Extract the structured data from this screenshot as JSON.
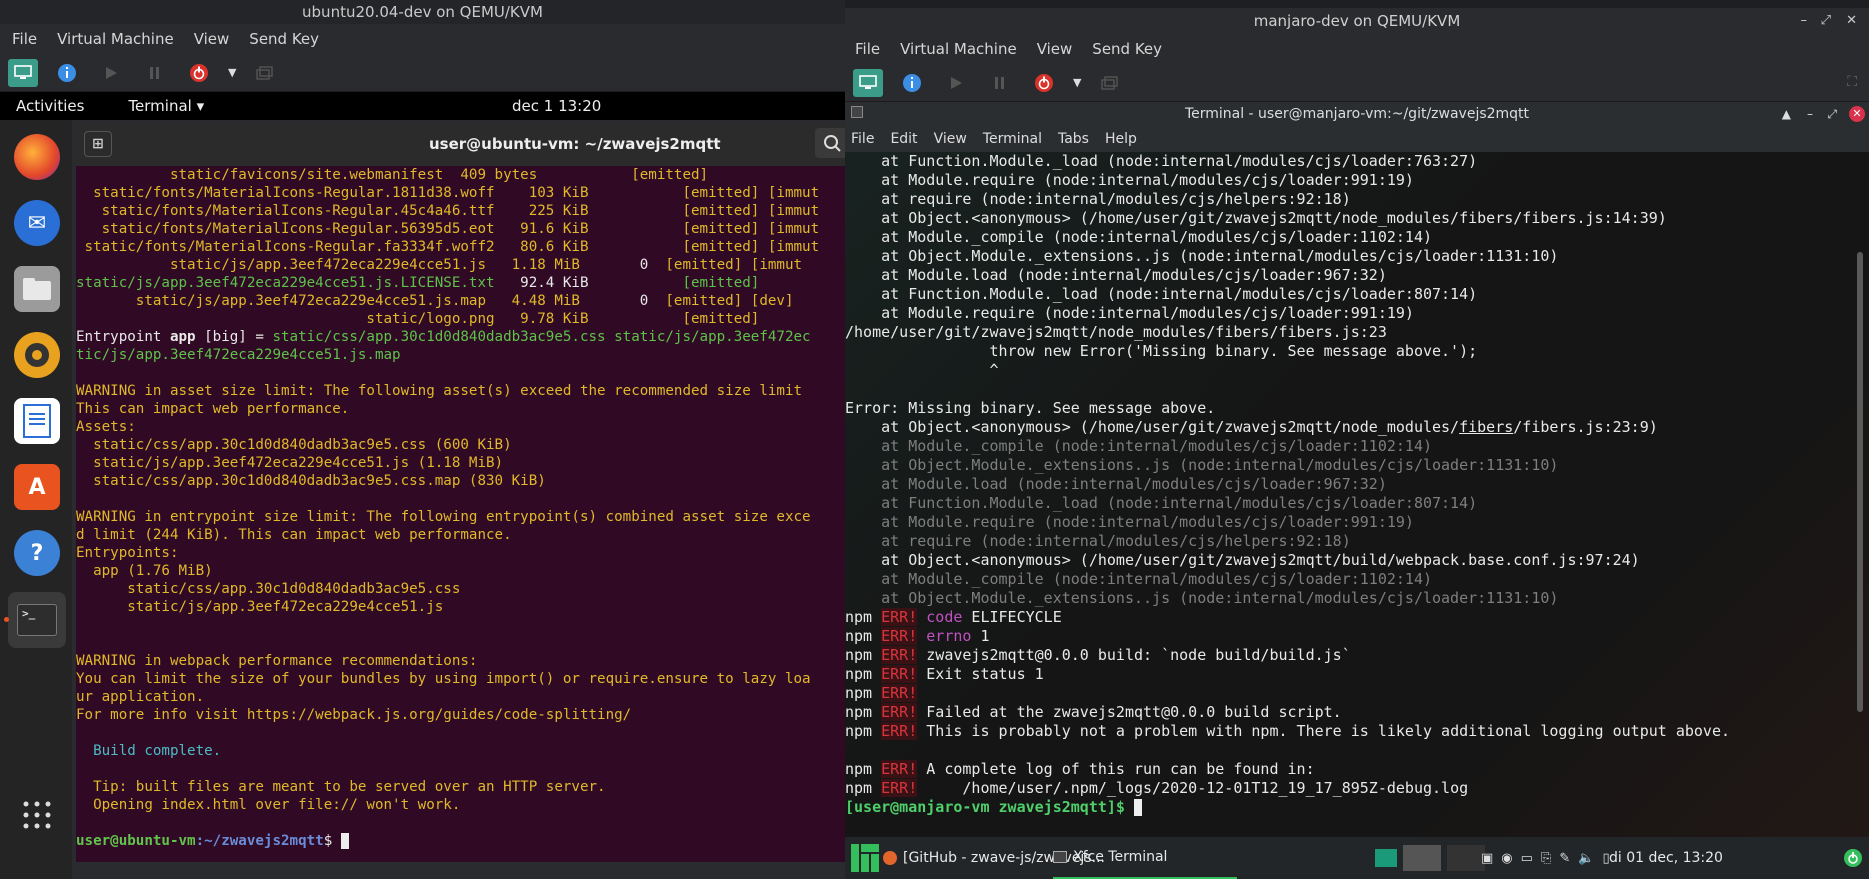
{
  "left_vm": {
    "title": "ubuntu20.04-dev on QEMU/KVM",
    "menu": [
      "File",
      "Virtual Machine",
      "View",
      "Send Key"
    ],
    "topbar": {
      "activities": "Activities",
      "app": "Terminal ▾",
      "clock": "dec 1  13:20"
    },
    "terminal_title": "user@ubuntu-vm: ~/zwavejs2mqtt",
    "lines": [
      [
        [
          "y",
          "           static/favicons/site.webmanifest  409 bytes           [emitted]"
        ]
      ],
      [
        [
          "y",
          "  static/fonts/MaterialIcons-Regular.1811d38.woff    103 KiB           [emitted] [immut"
        ]
      ],
      [
        [
          "y",
          "   static/fonts/MaterialIcons-Regular.45c4a46.ttf    225 KiB           [emitted] [immut"
        ]
      ],
      [
        [
          "y",
          "   static/fonts/MaterialIcons-Regular.56395d5.eot   91.6 KiB           [emitted] [immut"
        ]
      ],
      [
        [
          "y",
          " static/fonts/MaterialIcons-Regular.fa3334f.woff2   80.6 KiB           [emitted] [immut"
        ]
      ],
      [
        [
          "y",
          "           static/js/app.3eef472eca229e4cce51.js   1.18 MiB       "
        ],
        [
          "w",
          "0"
        ],
        [
          "y",
          "  [emitted] [immut"
        ]
      ],
      [
        [
          "g",
          "static/js/app.3eef472eca229e4cce51.js.LICENSE.txt"
        ],
        [
          "w",
          "   92.4 KiB           "
        ],
        [
          "g",
          "[emitted]"
        ]
      ],
      [
        [
          "y",
          "       static/js/app.3eef472eca229e4cce51.js.map   4.48 MiB       "
        ],
        [
          "w",
          "0"
        ],
        [
          "y",
          "  [emitted] [dev]"
        ]
      ],
      [
        [
          "y",
          "                                  static/logo.png   9.78 KiB           [emitted]"
        ]
      ],
      [
        [
          "w",
          "Entrypoint "
        ],
        [
          "wb",
          "app"
        ],
        [
          "w",
          " [big] = "
        ],
        [
          "g",
          "static/css/app.30c1d0d840dadb3ac9e5.css static/js/app.3eef472ec"
        ]
      ],
      [
        [
          "g",
          "tic/js/app.3eef472eca229e4cce51.js.map"
        ]
      ],
      [
        [
          "w",
          " "
        ]
      ],
      [
        [
          "y",
          "WARNING in asset size limit: The following asset(s) exceed the recommended size limit"
        ]
      ],
      [
        [
          "y",
          "This can impact web performance."
        ]
      ],
      [
        [
          "y",
          "Assets:"
        ]
      ],
      [
        [
          "y",
          "  static/css/app.30c1d0d840dadb3ac9e5.css (600 KiB)"
        ]
      ],
      [
        [
          "y",
          "  static/js/app.3eef472eca229e4cce51.js (1.18 MiB)"
        ]
      ],
      [
        [
          "y",
          "  static/css/app.30c1d0d840dadb3ac9e5.css.map (830 KiB)"
        ]
      ],
      [
        [
          "w",
          " "
        ]
      ],
      [
        [
          "y",
          "WARNING in entrypoint size limit: The following entrypoint(s) combined asset size exce"
        ]
      ],
      [
        [
          "y",
          "d limit (244 KiB). This can impact web performance."
        ]
      ],
      [
        [
          "y",
          "Entrypoints:"
        ]
      ],
      [
        [
          "y",
          "  app (1.76 MiB)"
        ]
      ],
      [
        [
          "y",
          "      static/css/app.30c1d0d840dadb3ac9e5.css"
        ]
      ],
      [
        [
          "y",
          "      static/js/app.3eef472eca229e4cce51.js"
        ]
      ],
      [
        [
          "w",
          " "
        ]
      ],
      [
        [
          "w",
          " "
        ]
      ],
      [
        [
          "y",
          "WARNING in webpack performance recommendations:"
        ]
      ],
      [
        [
          "y",
          "You can limit the size of your bundles by using import() or require.ensure to lazy loa"
        ]
      ],
      [
        [
          "y",
          "ur application."
        ]
      ],
      [
        [
          "y",
          "For more info visit https://webpack.js.org/guides/code-splitting/"
        ]
      ],
      [
        [
          "w",
          " "
        ]
      ],
      [
        [
          "c",
          "  Build complete."
        ]
      ],
      [
        [
          "w",
          " "
        ]
      ],
      [
        [
          "y",
          "  Tip: built files are meant to be served over an HTTP server."
        ]
      ],
      [
        [
          "y",
          "  Opening index.html over file:// won't work."
        ]
      ],
      [
        [
          "w",
          " "
        ]
      ]
    ],
    "prompt_user": "user@ubuntu-vm",
    "prompt_path": ":~/zwavejs2mqtt",
    "prompt_sym": "$ "
  },
  "right_vm": {
    "title": "manjaro-dev on QEMU/KVM",
    "menu": [
      "File",
      "Virtual Machine",
      "View",
      "Send Key"
    ],
    "terminal_title": "Terminal - user@manjaro-vm:~/git/zwavejs2mqtt",
    "term_menu": [
      "File",
      "Edit",
      "View",
      "Terminal",
      "Tabs",
      "Help"
    ],
    "lines": [
      [
        [
          "n",
          "    at Function.Module._load (node:internal/modules/cjs/loader:763:27)"
        ]
      ],
      [
        [
          "n",
          "    at Module.require (node:internal/modules/cjs/loader:991:19)"
        ]
      ],
      [
        [
          "n",
          "    at require (node:internal/modules/cjs/helpers:92:18)"
        ]
      ],
      [
        [
          "n",
          "    at Object.<anonymous> (/home/user/git/zwavejs2mqtt/node_modules/fibers/fibers.js:14:39)"
        ]
      ],
      [
        [
          "n",
          "    at Module._compile (node:internal/modules/cjs/loader:1102:14)"
        ]
      ],
      [
        [
          "n",
          "    at Object.Module._extensions..js (node:internal/modules/cjs/loader:1131:10)"
        ]
      ],
      [
        [
          "n",
          "    at Module.load (node:internal/modules/cjs/loader:967:32)"
        ]
      ],
      [
        [
          "n",
          "    at Function.Module._load (node:internal/modules/cjs/loader:807:14)"
        ]
      ],
      [
        [
          "n",
          "    at Module.require (node:internal/modules/cjs/loader:991:19)"
        ]
      ],
      [
        [
          "n",
          "/home/user/git/zwavejs2mqtt/node_modules/fibers/fibers.js:23"
        ]
      ],
      [
        [
          "n",
          "                throw new Error('Missing binary. See message above.');"
        ]
      ],
      [
        [
          "n",
          "                ^"
        ]
      ],
      [
        [
          "n",
          " "
        ]
      ],
      [
        [
          "n",
          "Error: Missing binary. See message above."
        ]
      ],
      [
        [
          "n",
          "    at Object.<anonymous> (/home/user/git/zwavejs2mqtt/node_modules/"
        ],
        [
          "u",
          "fibers"
        ],
        [
          "n",
          "/fibers.js:23:9)"
        ]
      ],
      [
        [
          "d",
          "    at Module._compile (node:internal/modules/cjs/loader:1102:14)"
        ]
      ],
      [
        [
          "d",
          "    at Object.Module._extensions..js (node:internal/modules/cjs/loader:1131:10)"
        ]
      ],
      [
        [
          "d",
          "    at Module.load (node:internal/modules/cjs/loader:967:32)"
        ]
      ],
      [
        [
          "d",
          "    at Function.Module._load (node:internal/modules/cjs/loader:807:14)"
        ]
      ],
      [
        [
          "d",
          "    at Module.require (node:internal/modules/cjs/loader:991:19)"
        ]
      ],
      [
        [
          "d",
          "    at require (node:internal/modules/cjs/helpers:92:18)"
        ]
      ],
      [
        [
          "n",
          "    at Object.<anonymous> (/home/user/git/zwavejs2mqtt/build/webpack.base.conf.js:97:24)"
        ]
      ],
      [
        [
          "d",
          "    at Module._compile (node:internal/modules/cjs/loader:1102:14)"
        ]
      ],
      [
        [
          "d",
          "    at Object.Module._extensions..js (node:internal/modules/cjs/loader:1131:10)"
        ]
      ],
      [
        [
          "n",
          "npm "
        ],
        [
          "e",
          "ERR!"
        ],
        [
          "n",
          " "
        ],
        [
          "m",
          "code"
        ],
        [
          "n",
          " ELIFECYCLE"
        ]
      ],
      [
        [
          "n",
          "npm "
        ],
        [
          "e",
          "ERR!"
        ],
        [
          "n",
          " "
        ],
        [
          "m",
          "errno"
        ],
        [
          "n",
          " 1"
        ]
      ],
      [
        [
          "n",
          "npm "
        ],
        [
          "e",
          "ERR!"
        ],
        [
          "n",
          " zwavejs2mqtt@0.0.0 build: `node build/build.js`"
        ]
      ],
      [
        [
          "n",
          "npm "
        ],
        [
          "e",
          "ERR!"
        ],
        [
          "n",
          " Exit status 1"
        ]
      ],
      [
        [
          "n",
          "npm "
        ],
        [
          "e",
          "ERR!"
        ]
      ],
      [
        [
          "n",
          "npm "
        ],
        [
          "e",
          "ERR!"
        ],
        [
          "n",
          " Failed at the zwavejs2mqtt@0.0.0 build script."
        ]
      ],
      [
        [
          "n",
          "npm "
        ],
        [
          "e",
          "ERR!"
        ],
        [
          "n",
          " This is probably not a problem with npm. There is likely additional logging output above."
        ]
      ],
      [
        [
          "n",
          " "
        ]
      ],
      [
        [
          "n",
          "npm "
        ],
        [
          "e",
          "ERR!"
        ],
        [
          "n",
          " A complete log of this run can be found in:"
        ]
      ],
      [
        [
          "n",
          "npm "
        ],
        [
          "e",
          "ERR!"
        ],
        [
          "n",
          "     /home/user/.npm/_logs/2020-12-01T12_19_17_895Z-debug.log"
        ]
      ]
    ],
    "prompt": "[user@manjaro-vm zwavejs2mqtt]$ ",
    "taskbar": {
      "browser": "[GitHub - zwave-js/zwavejs...",
      "terminal": "Xfce Terminal",
      "clock": "di 01 dec, 13:20"
    }
  }
}
